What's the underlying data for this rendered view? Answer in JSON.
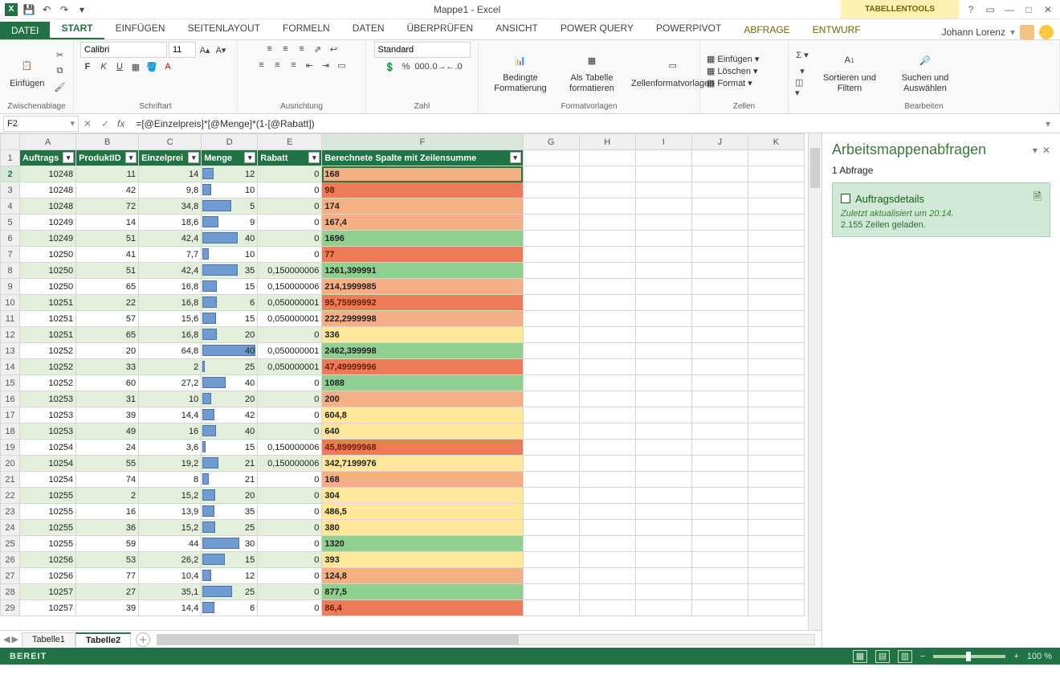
{
  "app": {
    "title": "Mappe1 - Excel",
    "context_tools": "TABELLENTOOLS"
  },
  "window_controls": {
    "help": "?",
    "ribbon_toggle": "▭",
    "min": "—",
    "max": "□",
    "close": "✕"
  },
  "user": {
    "name": "Johann Lorenz"
  },
  "qat": {
    "save": "💾",
    "undo": "↶",
    "redo": "↷",
    "custom": "▾"
  },
  "tabs": {
    "file": "DATEI",
    "items": [
      "START",
      "EINFÜGEN",
      "SEITENLAYOUT",
      "FORMELN",
      "DATEN",
      "ÜBERPRÜFEN",
      "ANSICHT",
      "POWER QUERY",
      "POWERPIVOT"
    ],
    "context": [
      "ABFRAGE",
      "ENTWURF"
    ],
    "active": "START"
  },
  "ribbon": {
    "clipboard": {
      "label": "Zwischenablage",
      "paste": "Einfügen"
    },
    "font": {
      "label": "Schriftart",
      "font": "Calibri",
      "size": "11",
      "bold": "F",
      "italic": "K",
      "underline": "U"
    },
    "align": {
      "label": "Ausrichtung"
    },
    "number": {
      "label": "Zahl",
      "format": "Standard"
    },
    "styles": {
      "label": "Formatvorlagen",
      "cond": "Bedingte Formatierung",
      "cond2": "",
      "astable": "Als Tabelle formatieren",
      "astable2": "",
      "cellstyles": "Zellenformatvorlagen"
    },
    "cells": {
      "label": "Zellen",
      "insert": "Einfügen",
      "delete": "Löschen",
      "format": "Format"
    },
    "editing": {
      "label": "Bearbeiten",
      "sort": "Sortieren und Filtern",
      "find": "Suchen und Auswählen"
    }
  },
  "formula_bar": {
    "name": "F2",
    "formula": "=[@Einzelpreis]*[@Menge]*(1-[@Rabatt])"
  },
  "columns": [
    "A",
    "B",
    "C",
    "D",
    "E",
    "F",
    "G",
    "H",
    "I",
    "J",
    "K"
  ],
  "table_headers": [
    "Auftrags",
    "ProduktID",
    "Einzelprei",
    "Menge",
    "Rabatt",
    "Berechnete Spalte mit Zeilensumme"
  ],
  "rows": [
    {
      "n": 2,
      "a": "10248",
      "b": "11",
      "c": "14",
      "bar": 20,
      "d": "12",
      "e": "0",
      "f": "168",
      "heat": "h-o",
      "active": true
    },
    {
      "n": 3,
      "a": "10248",
      "b": "42",
      "c": "9,8",
      "bar": 16,
      "d": "10",
      "e": "0",
      "f": "98",
      "heat": "h-r"
    },
    {
      "n": 4,
      "a": "10248",
      "b": "72",
      "c": "34,8",
      "bar": 52,
      "d": "5",
      "e": "0",
      "f": "174",
      "heat": "h-o"
    },
    {
      "n": 5,
      "a": "10249",
      "b": "14",
      "c": "18,6",
      "bar": 28,
      "d": "9",
      "e": "0",
      "f": "167,4",
      "heat": "h-o"
    },
    {
      "n": 6,
      "a": "10249",
      "b": "51",
      "c": "42,4",
      "bar": 63,
      "d": "40",
      "e": "0",
      "f": "1696",
      "heat": "h-g"
    },
    {
      "n": 7,
      "a": "10250",
      "b": "41",
      "c": "7,7",
      "bar": 12,
      "d": "10",
      "e": "0",
      "f": "77",
      "heat": "h-r"
    },
    {
      "n": 8,
      "a": "10250",
      "b": "51",
      "c": "42,4",
      "bar": 63,
      "d": "35",
      "e": "0,150000006",
      "f": "1261,399991",
      "heat": "h-g"
    },
    {
      "n": 9,
      "a": "10250",
      "b": "65",
      "c": "16,8",
      "bar": 26,
      "d": "15",
      "e": "0,150000006",
      "f": "214,1999985",
      "heat": "h-o"
    },
    {
      "n": 10,
      "a": "10251",
      "b": "22",
      "c": "16,8",
      "bar": 26,
      "d": "6",
      "e": "0,050000001",
      "f": "95,75999992",
      "heat": "h-r"
    },
    {
      "n": 11,
      "a": "10251",
      "b": "57",
      "c": "15,6",
      "bar": 24,
      "d": "15",
      "e": "0,050000001",
      "f": "222,2999998",
      "heat": "h-o"
    },
    {
      "n": 12,
      "a": "10251",
      "b": "65",
      "c": "16,8",
      "bar": 26,
      "d": "20",
      "e": "0",
      "f": "336",
      "heat": "h-y"
    },
    {
      "n": 13,
      "a": "10252",
      "b": "20",
      "c": "64,8",
      "bar": 95,
      "d": "40",
      "e": "0,050000001",
      "f": "2462,399998",
      "heat": "h-g"
    },
    {
      "n": 14,
      "a": "10252",
      "b": "33",
      "c": "2",
      "bar": 4,
      "d": "25",
      "e": "0,050000001",
      "f": "47,49999996",
      "heat": "h-r"
    },
    {
      "n": 15,
      "a": "10252",
      "b": "60",
      "c": "27,2",
      "bar": 41,
      "d": "40",
      "e": "0",
      "f": "1088",
      "heat": "h-g"
    },
    {
      "n": 16,
      "a": "10253",
      "b": "31",
      "c": "10",
      "bar": 15,
      "d": "20",
      "e": "0",
      "f": "200",
      "heat": "h-o"
    },
    {
      "n": 17,
      "a": "10253",
      "b": "39",
      "c": "14,4",
      "bar": 22,
      "d": "42",
      "e": "0",
      "f": "604,8",
      "heat": "h-y"
    },
    {
      "n": 18,
      "a": "10253",
      "b": "49",
      "c": "16",
      "bar": 24,
      "d": "40",
      "e": "0",
      "f": "640",
      "heat": "h-y"
    },
    {
      "n": 19,
      "a": "10254",
      "b": "24",
      "c": "3,6",
      "bar": 6,
      "d": "15",
      "e": "0,150000006",
      "f": "45,89999968",
      "heat": "h-r"
    },
    {
      "n": 20,
      "a": "10254",
      "b": "55",
      "c": "19,2",
      "bar": 29,
      "d": "21",
      "e": "0,150000006",
      "f": "342,7199976",
      "heat": "h-y"
    },
    {
      "n": 21,
      "a": "10254",
      "b": "74",
      "c": "8",
      "bar": 12,
      "d": "21",
      "e": "0",
      "f": "168",
      "heat": "h-o"
    },
    {
      "n": 22,
      "a": "10255",
      "b": "2",
      "c": "15,2",
      "bar": 23,
      "d": "20",
      "e": "0",
      "f": "304",
      "heat": "h-y"
    },
    {
      "n": 23,
      "a": "10255",
      "b": "16",
      "c": "13,9",
      "bar": 21,
      "d": "35",
      "e": "0",
      "f": "486,5",
      "heat": "h-y"
    },
    {
      "n": 24,
      "a": "10255",
      "b": "36",
      "c": "15,2",
      "bar": 23,
      "d": "25",
      "e": "0",
      "f": "380",
      "heat": "h-y"
    },
    {
      "n": 25,
      "a": "10255",
      "b": "59",
      "c": "44",
      "bar": 66,
      "d": "30",
      "e": "0",
      "f": "1320",
      "heat": "h-g"
    },
    {
      "n": 26,
      "a": "10256",
      "b": "53",
      "c": "26,2",
      "bar": 40,
      "d": "15",
      "e": "0",
      "f": "393",
      "heat": "h-y"
    },
    {
      "n": 27,
      "a": "10256",
      "b": "77",
      "c": "10,4",
      "bar": 16,
      "d": "12",
      "e": "0",
      "f": "124,8",
      "heat": "h-o"
    },
    {
      "n": 28,
      "a": "10257",
      "b": "27",
      "c": "35,1",
      "bar": 53,
      "d": "25",
      "e": "0",
      "f": "877,5",
      "heat": "h-g"
    },
    {
      "n": 29,
      "a": "10257",
      "b": "39",
      "c": "14,4",
      "bar": 22,
      "d": "6",
      "e": "0",
      "f": "86,4",
      "heat": "h-r"
    }
  ],
  "sheet_tabs": {
    "tabs": [
      "Tabelle1",
      "Tabelle2"
    ],
    "active": "Tabelle2"
  },
  "queries_pane": {
    "title": "Arbeitsmappenabfragen",
    "count": "1 Abfrage",
    "card": {
      "title": "Auftragsdetails",
      "subtitle": "Zuletzt aktualisiert um 20:14.",
      "rows": "2.155 Zeilen geladen."
    }
  },
  "status": {
    "ready": "BEREIT",
    "zoom": "100 %"
  }
}
